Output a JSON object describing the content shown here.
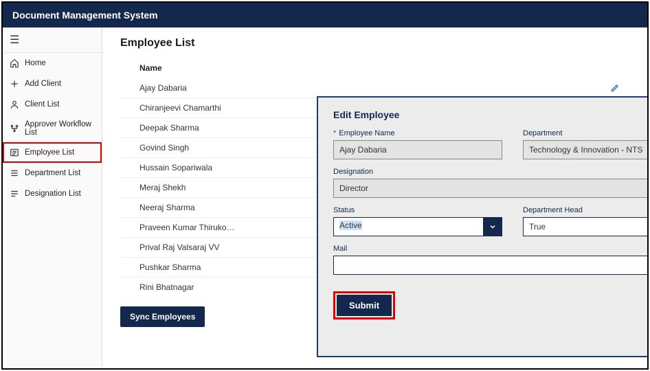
{
  "app": {
    "title": "Document Management System"
  },
  "sidebar": {
    "items": [
      {
        "label": "Home",
        "icon": "home-icon"
      },
      {
        "label": "Add Client",
        "icon": "plus-icon"
      },
      {
        "label": "Client List",
        "icon": "person-icon"
      },
      {
        "label": "Approver Workflow List",
        "icon": "workflow-icon"
      },
      {
        "label": "Employee List",
        "icon": "list-icon",
        "active": true
      },
      {
        "label": "Department List",
        "icon": "lines-icon"
      },
      {
        "label": "Designation List",
        "icon": "lines-icon"
      }
    ]
  },
  "page": {
    "title": "Employee List",
    "column_header": "Name",
    "sync_label": "Sync Employees",
    "rows": [
      "Ajay Dabaria",
      "Chiranjeevi Chamarthi",
      "Deepak Sharma",
      "Govind Singh",
      "Hussain Sopariwala",
      "Meraj Shekh",
      "Neeraj Sharma",
      "Praveen Kumar Thirukovalluru",
      "Prival Raj Valsaraj VV",
      "Pushkar Sharma",
      "Rini Bhatnagar"
    ]
  },
  "modal": {
    "title": "Edit Employee",
    "labels": {
      "employee_name": "Employee Name",
      "department": "Department",
      "designation": "Designation",
      "status": "Status",
      "department_head": "Department Head",
      "mail": "Mail"
    },
    "values": {
      "employee_name": "Ajay Dabaria",
      "department": "Technology & Innovation - NTS",
      "designation": "Director",
      "status": "Active",
      "department_head": "True",
      "mail": ""
    },
    "submit_label": "Submit"
  }
}
